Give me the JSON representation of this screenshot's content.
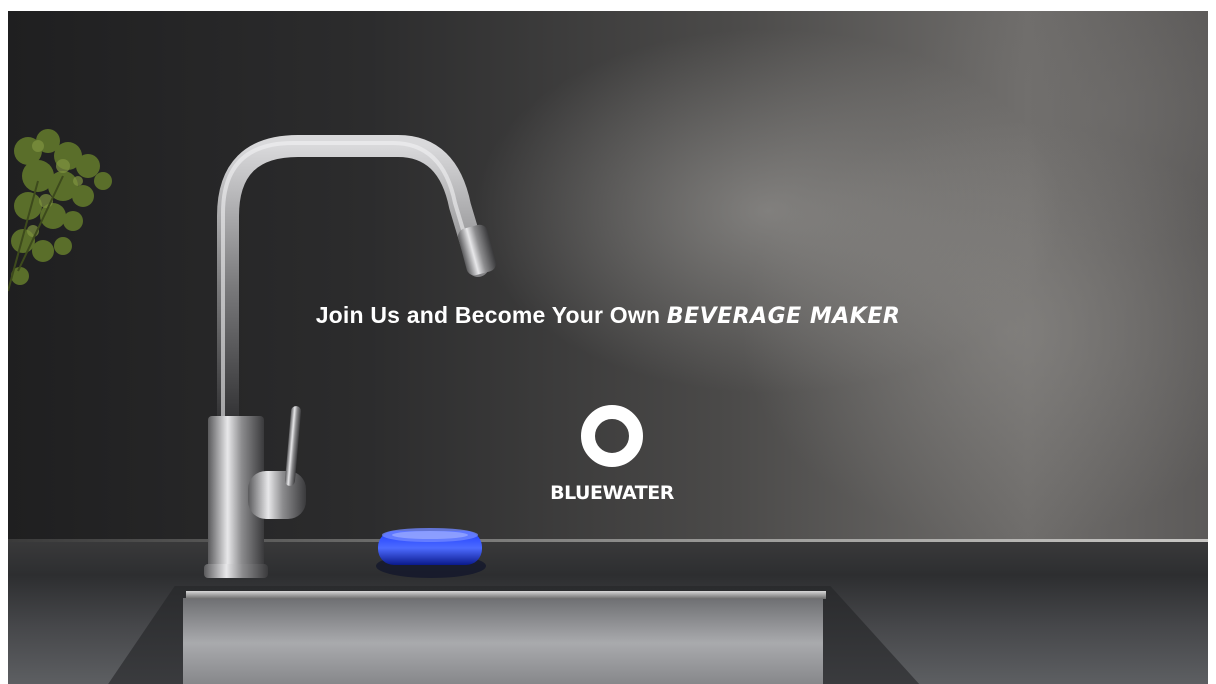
{
  "hero": {
    "headline_prefix": "Join Us and Become Your Own",
    "headline_accent": "BEVERAGE MAKER"
  },
  "brand": {
    "name": "BLUEWATER",
    "mark_color": "#ffffff"
  },
  "scene": {
    "device_glow_color": "#2b52ff",
    "icons": [
      "plant-icon",
      "faucet-icon",
      "beverage-device-icon",
      "bluewater-logo-icon"
    ]
  }
}
